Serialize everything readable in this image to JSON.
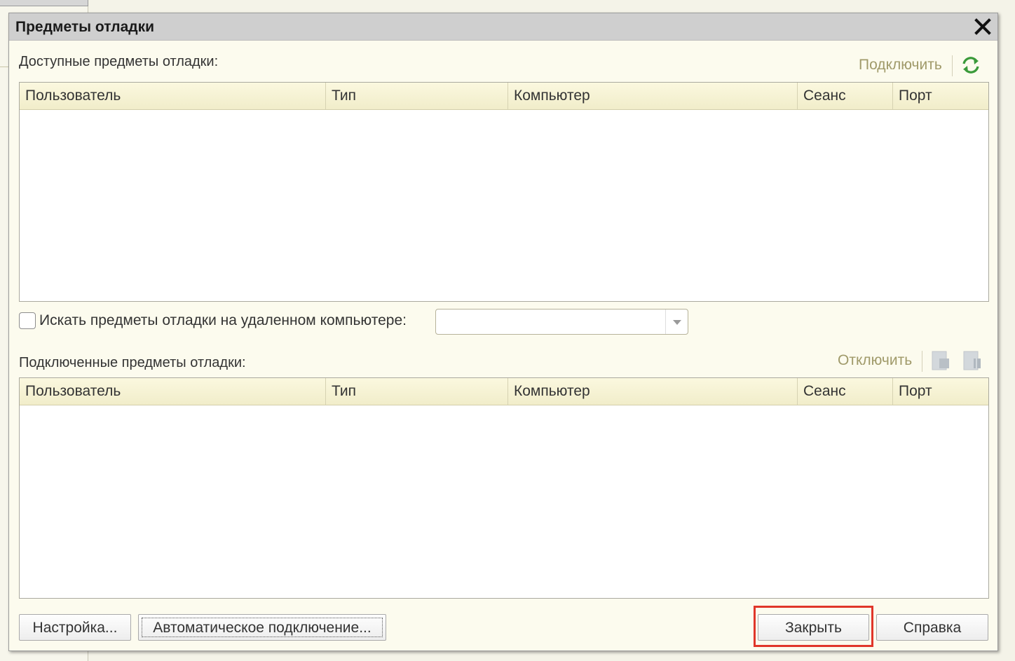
{
  "window": {
    "title": "Предметы отладки"
  },
  "available": {
    "label": "Доступные предметы отладки:",
    "connect_label": "Подключить",
    "columns": [
      "Пользователь",
      "Тип",
      "Компьютер",
      "Сеанс",
      "Порт"
    ],
    "rows": []
  },
  "remote": {
    "checkbox_label": "Искать предметы отладки на удаленном компьютере:",
    "checked": false,
    "computer_value": ""
  },
  "connected": {
    "label": "Подключенные предметы отладки:",
    "disconnect_label": "Отключить",
    "columns": [
      "Пользователь",
      "Тип",
      "Компьютер",
      "Сеанс",
      "Порт"
    ],
    "rows": []
  },
  "footer": {
    "settings_label": "Настройка...",
    "autoconnect_label": "Автоматическое подключение...",
    "close_label": "Закрыть",
    "help_label": "Справка"
  },
  "colors": {
    "link_disabled": "#a09a6a",
    "refresh_green": "#3a9a3a",
    "highlight_red": "#e0362a"
  }
}
